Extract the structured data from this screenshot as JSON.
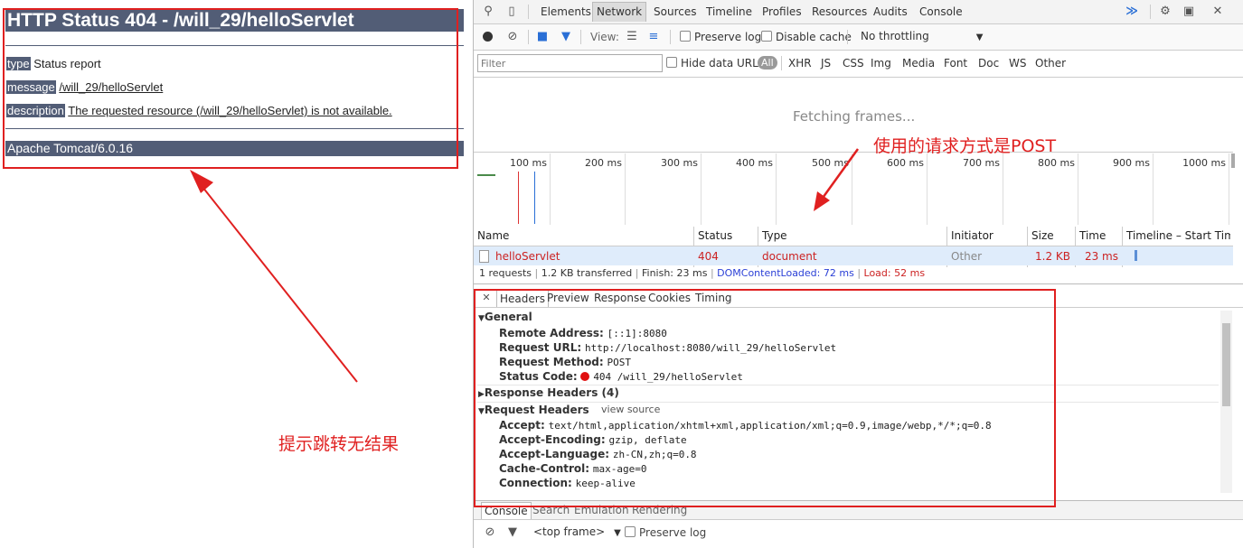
{
  "tomcat": {
    "title": "HTTP Status 404 - /will_29/helloServlet",
    "rows": [
      {
        "label": "type",
        "value": "Status report",
        "underline": false
      },
      {
        "label": "message",
        "value": "/will_29/helloServlet",
        "underline": true
      },
      {
        "label": "description",
        "value": "The requested resource (/will_29/helloServlet) is not available.",
        "underline": true
      }
    ],
    "footer": "Apache Tomcat/6.0.16"
  },
  "annotations": {
    "post_note": "使用的请求方式是POST",
    "result_note": "提示跳转无结果",
    "accent": "#e02020"
  },
  "devtools": {
    "tabs": [
      "Elements",
      "Network",
      "Sources",
      "Timeline",
      "Profiles",
      "Resources",
      "Audits",
      "Console"
    ],
    "active_tab": "Network",
    "toolbar": {
      "view_label": "View:",
      "preserve_log": "Preserve log",
      "disable_cache": "Disable cache",
      "throttling": "No throttling"
    },
    "filter": {
      "placeholder": "Filter",
      "hide_data_urls": "Hide data URLs",
      "types": [
        "All",
        "XHR",
        "JS",
        "CSS",
        "Img",
        "Media",
        "Font",
        "Doc",
        "WS",
        "Other"
      ]
    },
    "fetching": "Fetching frames...",
    "timeline_ticks": [
      "100 ms",
      "200 ms",
      "300 ms",
      "400 ms",
      "500 ms",
      "600 ms",
      "700 ms",
      "800 ms",
      "900 ms",
      "1000 ms"
    ],
    "columns": [
      "Name",
      "Status",
      "Type",
      "Initiator",
      "Size",
      "Time",
      "Timeline – Start Tim"
    ],
    "row": {
      "name": "helloServlet",
      "status": "404",
      "type": "document",
      "initiator": "Other",
      "size": "1.2 KB",
      "time": "23 ms"
    },
    "summary": {
      "requests": "1 requests",
      "transferred": "1.2 KB transferred",
      "finish": "Finish: 23 ms",
      "dcl": "DOMContentLoaded: 72 ms",
      "load": "Load: 52 ms"
    },
    "detail_tabs": [
      "Headers",
      "Preview",
      "Response",
      "Cookies",
      "Timing"
    ],
    "general": {
      "title": "General",
      "remote_address_k": "Remote Address:",
      "remote_address_v": "[::1]:8080",
      "request_url_k": "Request URL:",
      "request_url_v": "http://localhost:8080/will_29/helloServlet",
      "request_method_k": "Request Method:",
      "request_method_v": "POST",
      "status_code_k": "Status Code:",
      "status_code_v": "404 /will_29/helloServlet"
    },
    "response_headers": "Response Headers (4)",
    "request_headers": {
      "title": "Request Headers",
      "view_source": "view source",
      "accept_k": "Accept:",
      "accept_v": "text/html,application/xhtml+xml,application/xml;q=0.9,image/webp,*/*;q=0.8",
      "encoding_k": "Accept-Encoding:",
      "encoding_v": "gzip, deflate",
      "language_k": "Accept-Language:",
      "language_v": "zh-CN,zh;q=0.8",
      "cache_k": "Cache-Control:",
      "cache_v": "max-age=0",
      "connection_k": "Connection:",
      "connection_v": "keep-alive"
    },
    "drawer_tabs": [
      "Console",
      "Search",
      "Emulation",
      "Rendering"
    ],
    "console": {
      "frame": "<top frame>",
      "preserve_log": "Preserve log"
    }
  }
}
